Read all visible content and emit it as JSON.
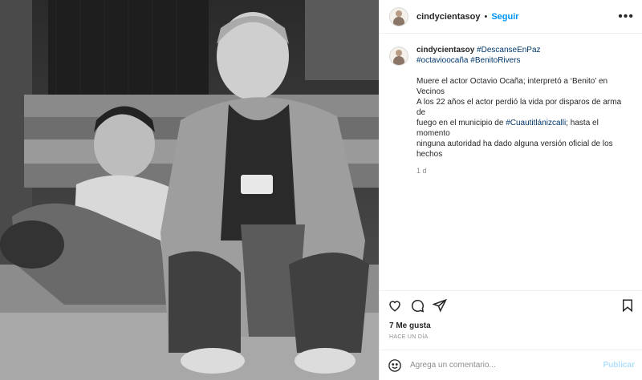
{
  "post": {
    "username": "cindycientasoy",
    "follow_label": "Seguir",
    "more_label": "•••",
    "caption": {
      "username": "cindycientasoy",
      "hashtags_line1": "#DescanseEnPaz",
      "hashtags_line2a": "#octavioocaña",
      "hashtags_line2b": "#BenitoRivers",
      "text_line1": "Muere el actor Octavio Ocaña; interpretó a ‘Benito’ en Vecinos",
      "text_line2": "A los 22 años el actor perdió la vida por disparos de arma de",
      "text_line3a": "fuego en el municipio de ",
      "text_line3_tag": "#Cuautitlánizcalli",
      "text_line3b": "; hasta el momento",
      "text_line4": "ninguna autoridad ha dado alguna versión oficial de los hechos",
      "age": "1 d"
    },
    "likes": "7 Me gusta",
    "posted_when": "HACE UN DÍA",
    "comment_placeholder": "Agrega un comentario...",
    "publish_label": "Publicar",
    "photo_description_icon": "photo-bw-two-people",
    "colors": {
      "link": "#0095f6",
      "hashtag": "#00376b",
      "muted": "#8e8e8e",
      "publish_disabled": "#b2dffc"
    }
  }
}
